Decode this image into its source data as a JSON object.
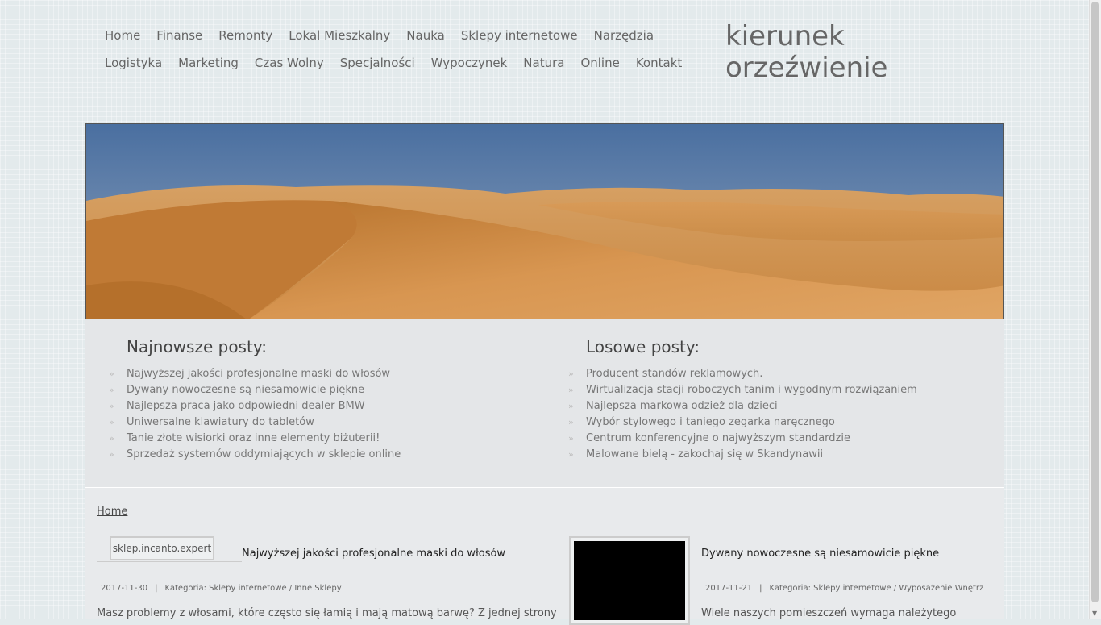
{
  "nav": {
    "row1": [
      "Home",
      "Finanse",
      "Remonty",
      "Lokal Mieszkalny",
      "Nauka",
      "Sklepy internetowe",
      "Narzędzia"
    ],
    "row2": [
      "Logistyka",
      "Marketing",
      "Czas Wolny",
      "Specjalności",
      "Wypoczynek",
      "Natura",
      "Online",
      "Kontakt"
    ]
  },
  "site": {
    "title_line1": "kierunek",
    "title_line2": "orzeźwienie"
  },
  "banner": {
    "icon": "desert-banner-image"
  },
  "latest": {
    "heading": "Najnowsze posty:",
    "items": [
      "Najwyższej jakości profesjonalne maski do włosów",
      "Dywany nowoczesne są niesamowicie piękne",
      "Najlepsza praca jako odpowiedni dealer BMW",
      "Uniwersalne klawiatury do tabletów",
      "Tanie złote wisiorki oraz inne elementy biżuterii!",
      "Sprzedaż systemów oddymiających w sklepie online"
    ]
  },
  "random": {
    "heading": "Losowe posty:",
    "items": [
      "Producent standów reklamowych.",
      "Wirtualizacja stacji roboczych tanim i wygodnym rozwiązaniem",
      "Najlepsza markowa odzież dla dzieci",
      "Wybór stylowego i taniego zegarka naręcznego",
      "Centrum konferencyjne o najwyższym standardzie",
      "Malowane bielą - zakochaj się w Skandynawii"
    ]
  },
  "breadcrumb": "Home",
  "articles": [
    {
      "thumb_text": "sklep.incanto.expert",
      "title": "Najwyższej jakości profesjonalne maski do włosów",
      "date": "2017-11-30",
      "sep": "|",
      "category": "Kategoria: Sklepy internetowe / Inne Sklepy",
      "excerpt": "Masz problemy z włosami, które często się łamią i mają matową barwę? Z jednej strony"
    },
    {
      "title": "Dywany nowoczesne są niesamowicie piękne",
      "date": "2017-11-21",
      "sep": "|",
      "category": "Kategoria: Sklepy internetowe / Wyposażenie Wnętrz",
      "excerpt": "Wiele naszych pomieszczeń wymaga należytego"
    }
  ]
}
